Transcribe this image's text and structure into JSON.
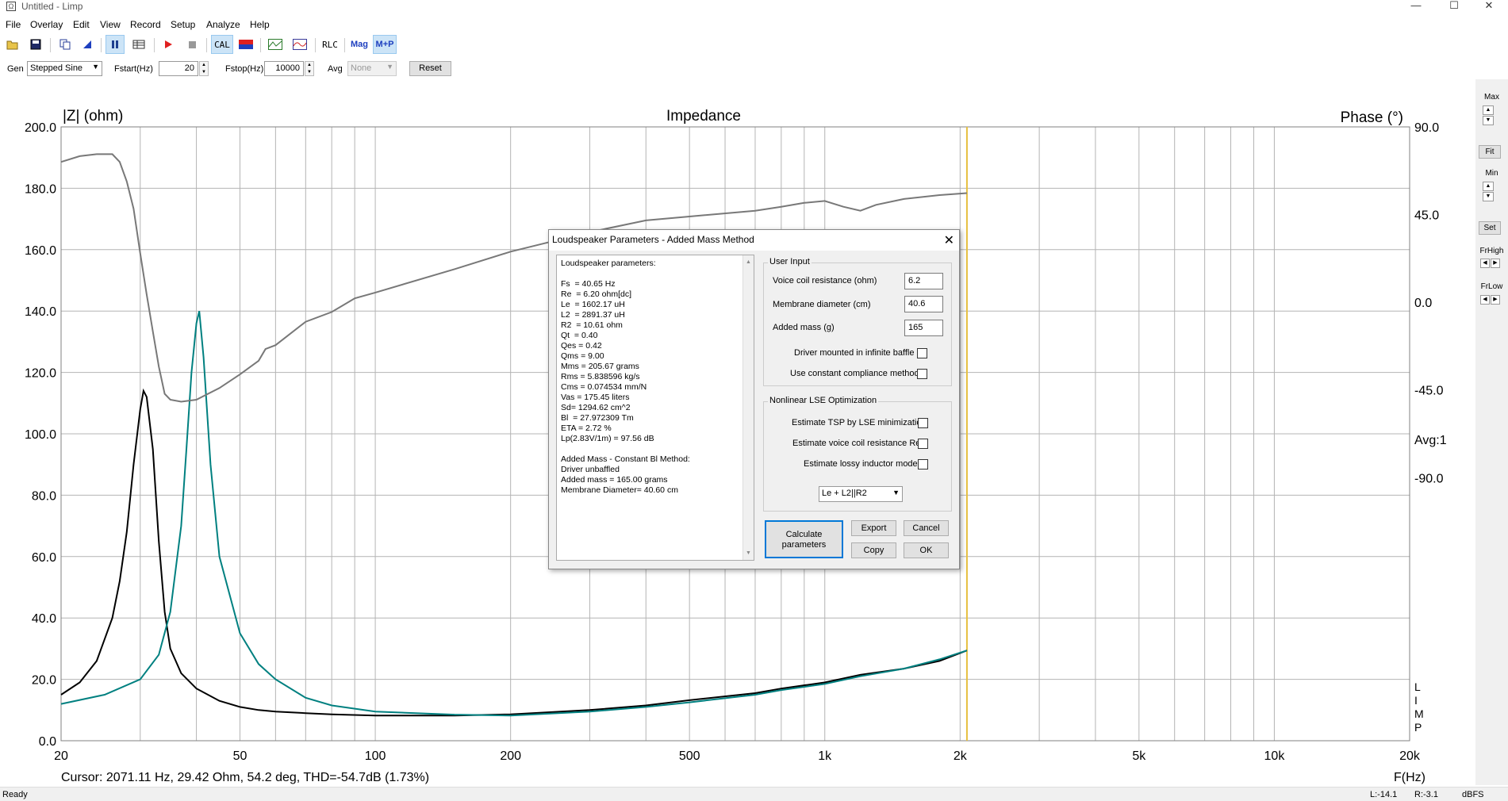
{
  "window": {
    "title": "Untitled - Limp",
    "minimize": "—",
    "maximize": "☐",
    "close": "✕"
  },
  "menu": [
    "File",
    "Overlay",
    "Edit",
    "View",
    "Record",
    "Setup",
    "Analyze",
    "Help"
  ],
  "toolbar": {
    "cal": "CAL",
    "rlc": "RLC",
    "mag": "Mag",
    "mp": "M+P",
    "icons": [
      "open-icon",
      "save-icon",
      "copy-icon",
      "cursor-icon",
      "pause-icon",
      "table-icon",
      "record-icon",
      "stop-icon",
      "cal-icon",
      "flag-icon",
      "graph-green-icon",
      "graph-red-icon"
    ]
  },
  "genbar": {
    "gen_label": "Gen",
    "gen_value": "Stepped Sine",
    "fstart_label": "Fstart(Hz)",
    "fstart_value": "20",
    "fstop_label": "Fstop(Hz)",
    "fstop_value": "10000",
    "avg_label": "Avg",
    "avg_value": "None",
    "reset_label": "Reset"
  },
  "right_panel": {
    "max": "Max",
    "fit": "Fit",
    "min": "Min",
    "set": "Set",
    "frhigh": "FrHigh",
    "frlow": "FrLow"
  },
  "status": {
    "ready": "Ready",
    "left": "L:-14.1",
    "right": "R:-3.1",
    "unit": "dBFS"
  },
  "chart_data": {
    "type": "line",
    "title": "Impedance",
    "ylabel": "|Z| (ohm)",
    "y2label": "Phase (°)",
    "xlabel": "F(Hz)",
    "x_scale": "log",
    "xlim": [
      20,
      20000
    ],
    "ylim": [
      0,
      200
    ],
    "y2lim": [
      -225,
      90
    ],
    "x_ticks": [
      {
        "v": 20,
        "label": "20"
      },
      {
        "v": 50,
        "label": "50"
      },
      {
        "v": 100,
        "label": "100"
      },
      {
        "v": 200,
        "label": "200"
      },
      {
        "v": 500,
        "label": "500"
      },
      {
        "v": 1000,
        "label": "1k"
      },
      {
        "v": 2000,
        "label": "2k"
      },
      {
        "v": 5000,
        "label": "5k"
      },
      {
        "v": 10000,
        "label": "10k"
      },
      {
        "v": 20000,
        "label": "20k"
      }
    ],
    "y_ticks": [
      "0.0",
      "20.0",
      "40.0",
      "60.0",
      "80.0",
      "100.0",
      "120.0",
      "140.0",
      "160.0",
      "180.0",
      "200.0"
    ],
    "y2_ticks": [
      {
        "v": 90,
        "label": "90.0"
      },
      {
        "v": 45,
        "label": "45.0"
      },
      {
        "v": 0,
        "label": "0.0"
      },
      {
        "v": -45,
        "label": "-45.0"
      },
      {
        "v": -90,
        "label": "-90.0"
      }
    ],
    "avg_label": "Avg:1",
    "side_label": [
      "L",
      "I",
      "M",
      "P"
    ],
    "cursor_x": 2071.11,
    "cursor_text": "Cursor: 2071.11 Hz, 29.42 Ohm, 54.2 deg, THD=-54.7dB (1.73%)",
    "grid": true,
    "series": [
      {
        "color": "#000000",
        "x": [
          20,
          22,
          24,
          26,
          27,
          28,
          29,
          30,
          30.5,
          31,
          32,
          33,
          34,
          35,
          37,
          40,
          45,
          50,
          55,
          60,
          70,
          80,
          100,
          150,
          200,
          300,
          400,
          500,
          700,
          800,
          1000,
          1200,
          1500,
          1800,
          2071
        ],
        "y": [
          15,
          19,
          26,
          40,
          52,
          68,
          90,
          108,
          114,
          112,
          95,
          65,
          42,
          30,
          22,
          17,
          13,
          11,
          10,
          9.5,
          9,
          8.6,
          8.2,
          8.2,
          8.6,
          10,
          11.5,
          13.2,
          15.5,
          17,
          19,
          21.5,
          23.5,
          26,
          29.4
        ]
      },
      {
        "color": "#008080",
        "x": [
          20,
          25,
          30,
          33,
          35,
          37,
          38,
          39,
          40,
          40.6,
          41.5,
          43,
          45,
          50,
          55,
          60,
          70,
          80,
          100,
          150,
          200,
          300,
          400,
          500,
          700,
          800,
          1000,
          1200,
          1500,
          1800,
          2071
        ],
        "y": [
          12,
          15,
          20,
          28,
          42,
          70,
          95,
          120,
          136,
          140,
          125,
          90,
          60,
          35,
          25,
          20,
          14,
          11.5,
          9.5,
          8.5,
          8.2,
          9.5,
          11,
          12.5,
          15,
          16.5,
          18.5,
          21,
          23.5,
          26.5,
          29.4
        ]
      },
      {
        "color": "#787878",
        "x": [
          20,
          22,
          24,
          26,
          27,
          28,
          29,
          30,
          31,
          32,
          33,
          34,
          35,
          37,
          40,
          45,
          50,
          55,
          57,
          60,
          70,
          80,
          90,
          100,
          150,
          200,
          300,
          400,
          500,
          700,
          800,
          900,
          1000,
          1100,
          1200,
          1300,
          1500,
          1800,
          2071
        ],
        "y2": [
          72,
          75,
          76,
          76,
          72,
          62,
          48,
          25,
          4,
          -15,
          -33,
          -47,
          -50,
          -51,
          -50,
          -44,
          -37,
          -30,
          -24,
          -22,
          -10,
          -5,
          2,
          5,
          17,
          26,
          36,
          42,
          44,
          47,
          49,
          51,
          52,
          49,
          47,
          50,
          53,
          55,
          56
        ]
      }
    ]
  },
  "dialog": {
    "title": "Loudspeaker Parameters - Added Mass Method",
    "results": [
      "Loudspeaker parameters:",
      "",
      "Fs  = 40.65 Hz",
      "Re  = 6.20 ohm[dc]",
      "Le  = 1602.17 uH",
      "L2  = 2891.37 uH",
      "R2  = 10.61 ohm",
      "Qt  = 0.40",
      "Qes = 0.42",
      "Qms = 9.00",
      "Mms = 205.67 grams",
      "Rms = 5.838596 kg/s",
      "Cms = 0.074534 mm/N",
      "Vas = 175.45 liters",
      "Sd= 1294.62 cm^2",
      "Bl  = 27.972309 Tm",
      "ETA = 2.72 %",
      "Lp(2.83V/1m) = 97.56 dB",
      "",
      "Added Mass - Constant Bl Method:",
      "Driver unbaffled",
      "Added mass = 165.00 grams",
      "Membrane Diameter= 40.60 cm"
    ],
    "user_input": {
      "label": "User Input",
      "voice_coil_label": "Voice coil resistance (ohm)",
      "voice_coil_value": "6.2",
      "membrane_label": "Membrane diameter (cm)",
      "membrane_value": "40.6",
      "added_mass_label": "Added mass (g)",
      "added_mass_value": "165",
      "infinite_baffle_label": "Driver mounted in infinite baffle",
      "constant_compliance_label": "Use constant compliance method"
    },
    "nonlinear": {
      "label": "Nonlinear LSE Optimization",
      "estimate_tsp_label": "Estimate TSP by LSE minimization",
      "estimate_re_label": "Estimate voice coil resistance Re",
      "estimate_inductor_label": "Estimate lossy inductor model",
      "model_value": "Le + L2||R2"
    },
    "buttons": {
      "calculate": "Calculate parameters",
      "export": "Export",
      "cancel": "Cancel",
      "copy": "Copy",
      "ok": "OK"
    }
  }
}
